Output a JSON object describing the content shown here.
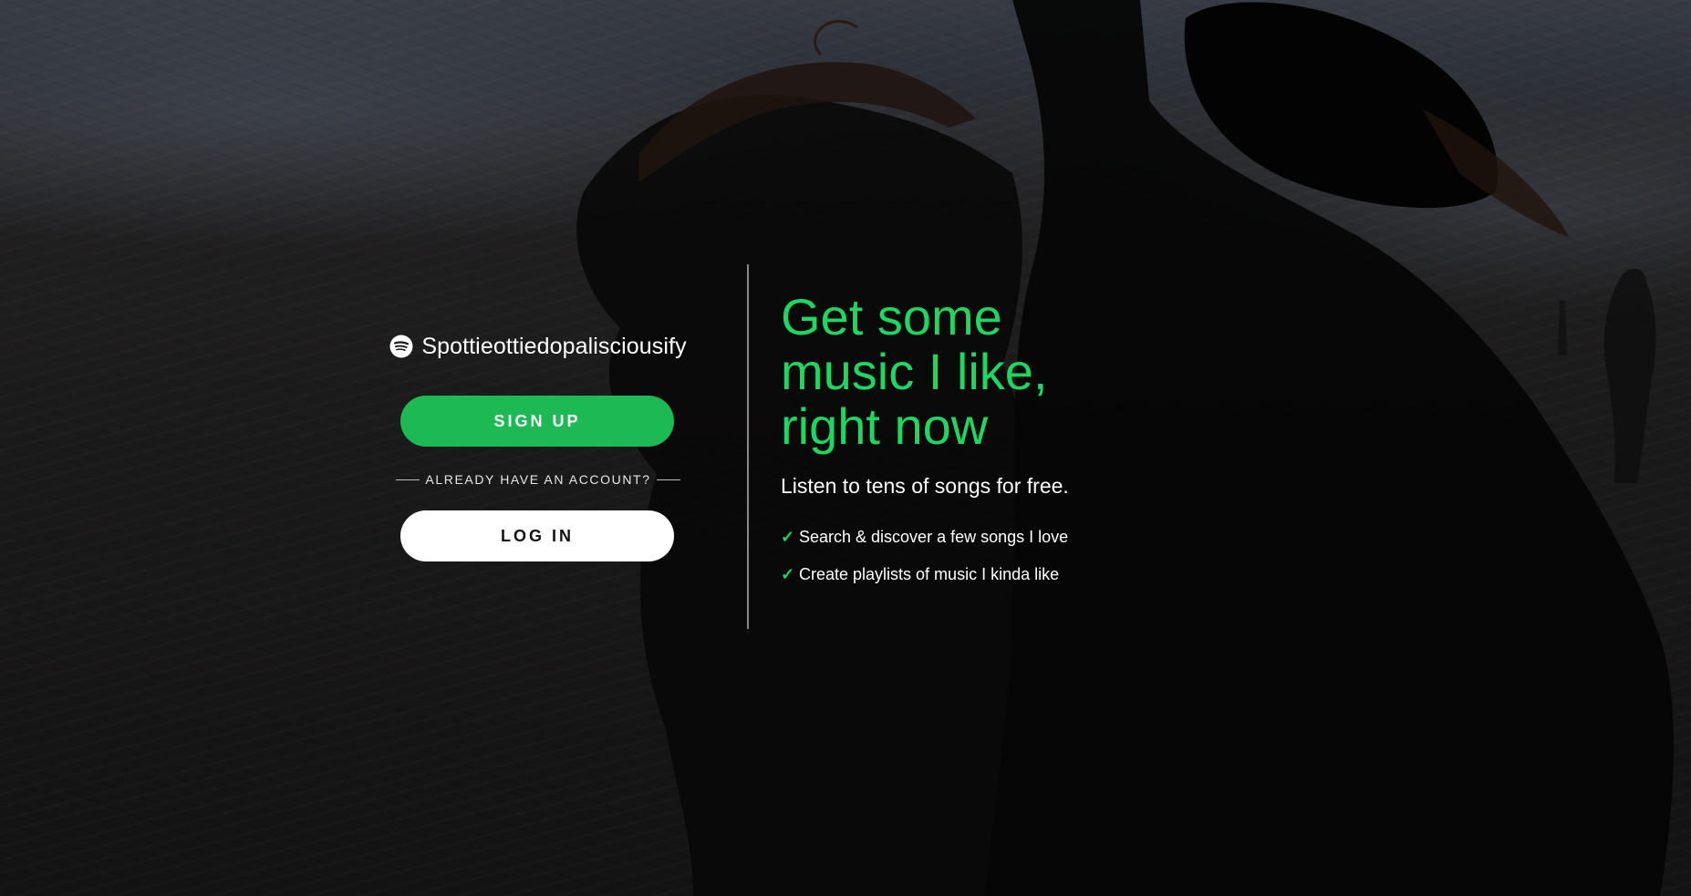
{
  "brand": {
    "name": "Spottieottiedopalisciousify",
    "logo_icon": "spotify-logo-icon"
  },
  "auth": {
    "signup_label": "SIGN UP",
    "divider_text": "ALREADY HAVE AN ACCOUNT?",
    "login_label": "LOG IN"
  },
  "hero": {
    "headline": "Get some music I like, right now",
    "subhead": "Listen to tens of songs for free.",
    "features": [
      {
        "icon": "checkmark-icon",
        "text": "Search & discover a few songs I love"
      },
      {
        "icon": "checkmark-icon",
        "text": "Create playlists of music I kinda like"
      }
    ]
  },
  "colors": {
    "accent": "#1db954",
    "headline": "#1ed760",
    "login_bg": "#ffffff",
    "background": "#1f1e1e"
  }
}
